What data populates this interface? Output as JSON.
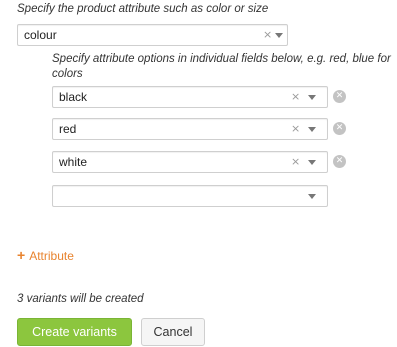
{
  "attribute_hint": "Specify the product attribute such as color or size",
  "attribute": {
    "value": "colour",
    "clear_glyph": "×"
  },
  "options_hint": "Specify attribute options in individual fields below, e.g. red, blue for colors",
  "options": [
    {
      "value": "black",
      "clear_glyph": "×",
      "remove_glyph": "✕"
    },
    {
      "value": "red",
      "clear_glyph": "×",
      "remove_glyph": "✕"
    },
    {
      "value": "white",
      "clear_glyph": "×",
      "remove_glyph": "✕"
    },
    {
      "value": ""
    }
  ],
  "add_attribute": {
    "plus": "+",
    "label": "Attribute"
  },
  "status_text": "3 variants will be created",
  "buttons": {
    "create": "Create variants",
    "cancel": "Cancel"
  },
  "colors": {
    "accent_orange": "#e8832e",
    "primary_green": "#8cc63e"
  }
}
